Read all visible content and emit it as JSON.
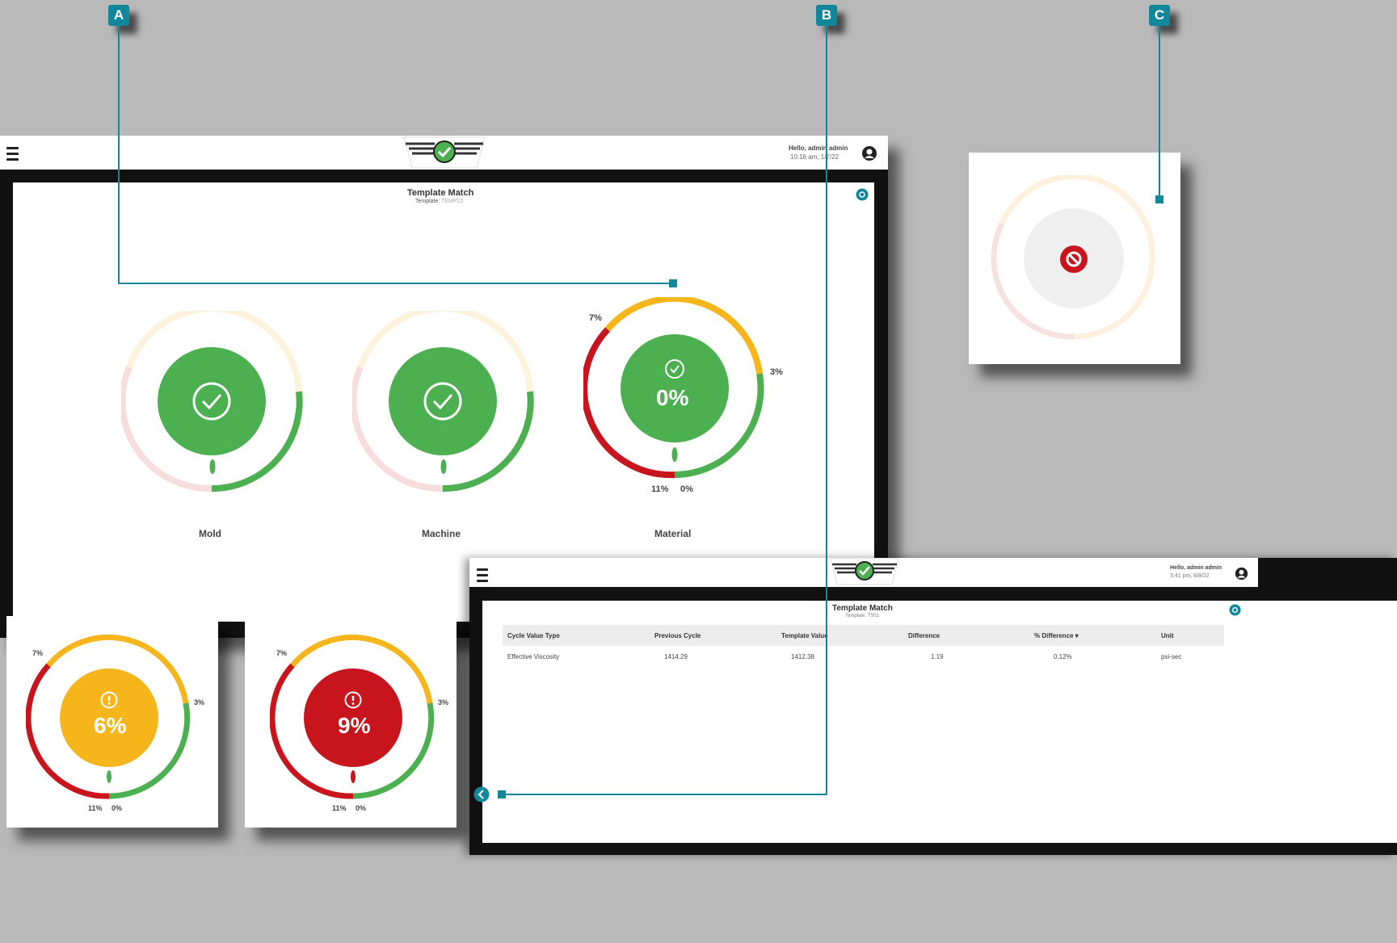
{
  "callouts": {
    "a": "A",
    "b": "B",
    "c": "C"
  },
  "main": {
    "greeting": "Hello, admin admin",
    "timestamp": "10:16 am, 1/7/22",
    "title": "Template Match",
    "subtitle_label": "Template:",
    "subtitle_value": "TEMP22",
    "gauges": [
      {
        "label": "Mold",
        "status": "match"
      },
      {
        "label": "Machine",
        "status": "match"
      },
      {
        "label": "Material",
        "status": "match",
        "value": "0%",
        "pct_top_left": "7%",
        "pct_right": "3%",
        "pct_bottom_left": "11%",
        "pct_bottom_right": "0%"
      }
    ]
  },
  "warning_panel": {
    "value": "6%",
    "pct_top_left": "7%",
    "pct_right": "3%",
    "pct_bottom_left": "11%",
    "pct_bottom_right": "0%"
  },
  "alarm_panel": {
    "value": "9%",
    "pct_top_left": "7%",
    "pct_right": "3%",
    "pct_bottom_left": "11%",
    "pct_bottom_right": "0%"
  },
  "table_view": {
    "greeting": "Hello, admin admin",
    "timestamp": "3:41 pm, 8/8/22",
    "title": "Template Match",
    "subtitle": "Template: TS01",
    "columns": [
      "Cycle Value Type",
      "Previous Cycle",
      "Template Value",
      "Difference",
      "% Difference ▾",
      "Unit"
    ],
    "rows": [
      [
        "Effective Viscosity",
        "1414.29",
        "1412.38",
        "1.19",
        "0.12%",
        "psi-sec"
      ]
    ]
  },
  "colors": {
    "accent": "#12879b",
    "green": "#4caf50",
    "yellow": "#f6b51b",
    "red": "#c8141c"
  },
  "icons": [
    "menu-icon",
    "user-icon",
    "check-icon",
    "alert-icon",
    "blocked-icon",
    "settings-icon",
    "collapse-icon"
  ]
}
